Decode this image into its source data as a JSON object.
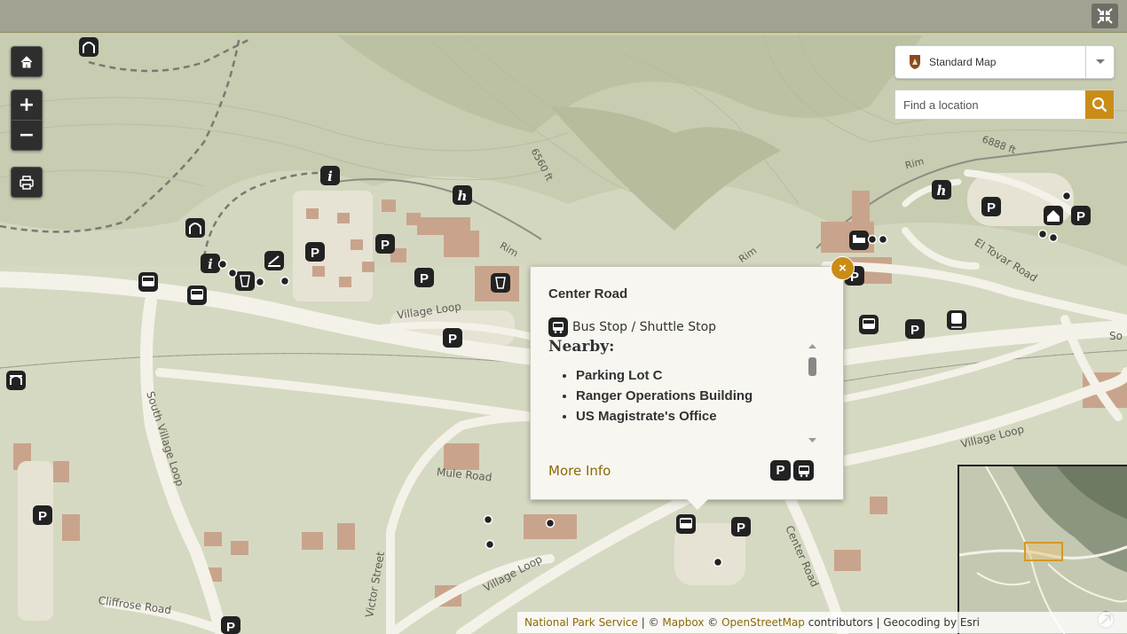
{
  "controls": {
    "fullscreen_icon": "collapse-icon",
    "home_icon": "home-icon",
    "zoom_in": "+",
    "zoom_out": "−",
    "print_icon": "printer-icon"
  },
  "basemap_select": {
    "selected": "Standard Map",
    "icon": "nps-arrowhead-icon"
  },
  "search": {
    "placeholder": "Find a location",
    "icon": "search-icon"
  },
  "map_labels": {
    "contour1": "6560 ft",
    "contour2": "6888 ft",
    "rim1": "Rim",
    "rim2": "Rim",
    "rim3": "Rim",
    "el_tovar": "El Tovar Road",
    "village_loop_top": "Village Loop",
    "village_loop_right": "Village Loop",
    "village_loop_bottom": "Village Loop",
    "south_village_loop": "South Village Loop",
    "mule_road": "Mule Road",
    "victor_street": "Victor Street",
    "cliffrose_road": "Cliffrose Road",
    "center_road": "Center Road",
    "so": "So"
  },
  "popup": {
    "title": "Center Road",
    "category": "Bus Stop / Shuttle Stop",
    "nearby_heading": "Nearby:",
    "nearby": [
      "Parking Lot C",
      "Ranger Operations Building",
      "US Magistrate's Office"
    ],
    "more_info": "More Info",
    "close_label": "×",
    "amenity_icons": [
      "parking-icon",
      "bus-icon"
    ]
  },
  "attribution": {
    "nps": "National Park Service",
    "sep1": " | © ",
    "mapbox": "Mapbox",
    "sep2": " © ",
    "osm": "OpenStreetMap",
    "rest": " contributors | Geocoding by Esri"
  },
  "colors": {
    "accent": "#c98d16",
    "link": "#8a6a08",
    "road": "#f4f2e8",
    "building": "#c9a48c"
  }
}
